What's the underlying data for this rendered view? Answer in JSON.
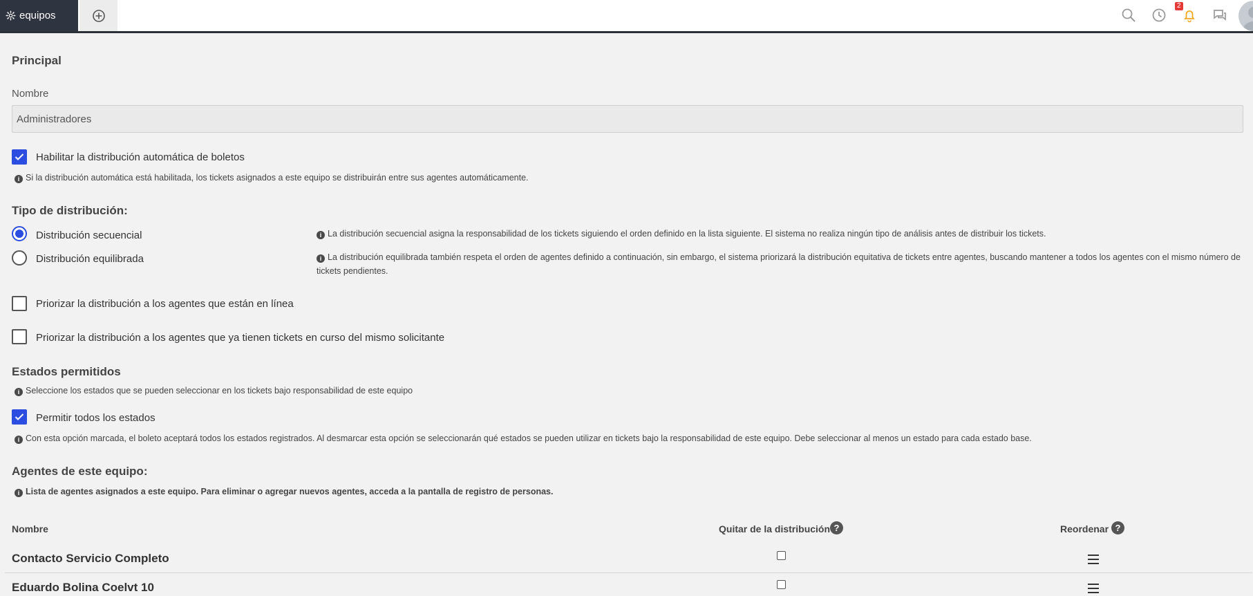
{
  "topbar": {
    "active_tab_label": "equipos",
    "notification_count": "2",
    "icons": [
      "gear-icon",
      "add-tab-icon",
      "search-icon",
      "history-icon",
      "bell-icon",
      "chat-icon",
      "avatar"
    ]
  },
  "principal": {
    "title": "Principal",
    "name_label": "Nombre",
    "name_value": "Administradores",
    "auto_distribution_label": "Habilitar la distribución automática de boletos",
    "auto_distribution_checked": true,
    "auto_distribution_hint": "Si la distribución automática está habilitada, los tickets asignados a este equipo se distribuirán entre sus agentes automáticamente."
  },
  "distribution": {
    "title": "Tipo de distribución:",
    "options": [
      {
        "label": "Distribución secuencial",
        "selected": true,
        "hint": "La distribución secuencial asigna la responsabilidad de los tickets siguiendo el orden definido en la lista siguiente. El sistema no realiza ningún tipo de análisis antes de distribuir los tickets."
      },
      {
        "label": "Distribución equilibrada",
        "selected": false,
        "hint": "La distribución equilibrada también respeta el orden de agentes definido a continuación, sin embargo, el sistema priorizará la distribución equitativa de tickets entre agentes, buscando mantener a todos los agentes con el mismo número de tickets pendientes."
      }
    ],
    "prioritize_online_label": "Priorizar la distribución a los agentes que están en línea",
    "prioritize_online_checked": false,
    "prioritize_same_requester_label": "Priorizar la distribución a los agentes que ya tienen tickets en curso del mismo solicitante",
    "prioritize_same_requester_checked": false
  },
  "states": {
    "title": "Estados permitidos",
    "hint": "Seleccione los estados que se pueden seleccionar en los tickets bajo responsabilidad de este equipo",
    "allow_all_label": "Permitir todos los estados",
    "allow_all_checked": true,
    "allow_all_hint": "Con esta opción marcada, el boleto aceptará todos los estados registrados. Al desmarcar esta opción se seleccionarán qué estados se pueden utilizar en tickets bajo la responsabilidad de este equipo. Debe seleccionar al menos un estado para cada estado base."
  },
  "agents": {
    "title": "Agentes de este equipo:",
    "hint": "Lista de agentes asignados a este equipo. Para eliminar o agregar nuevos agentes, acceda a la pantalla de registro de personas.",
    "columns": {
      "name": "Nombre",
      "remove": "Quitar de la distribución",
      "reorder": "Reordenar"
    },
    "rows": [
      {
        "name": "Contacto Servicio Completo",
        "removed": false
      },
      {
        "name": "Eduardo Bolina Coelvt 10",
        "removed": false
      }
    ]
  },
  "colors": {
    "accent": "#2b4ee0",
    "topbar_tab": "#2e3440",
    "badge": "#e53935",
    "bell": "#f5a623"
  }
}
